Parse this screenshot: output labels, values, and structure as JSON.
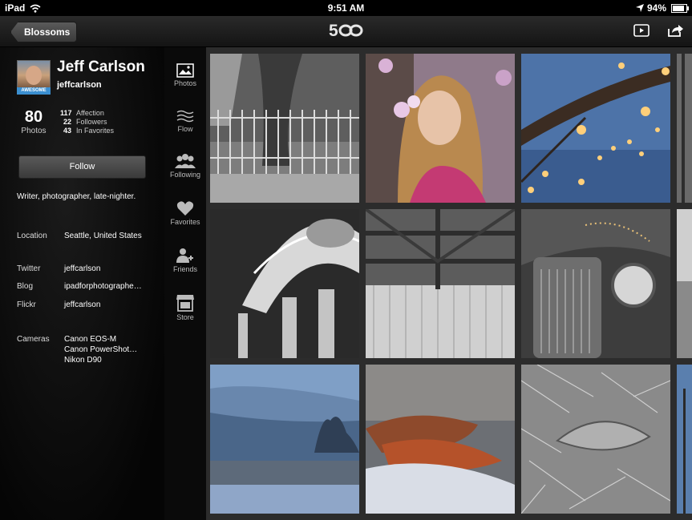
{
  "status_bar": {
    "device": "iPad",
    "time": "9:51 AM",
    "battery": "94%"
  },
  "nav": {
    "back_label": "Blossoms",
    "logo": "500"
  },
  "profile": {
    "name": "Jeff Carlson",
    "username": "jeffcarlson",
    "badge": "AWESOME",
    "photos_count": "80",
    "photos_label": "Photos",
    "stats": [
      {
        "value": "117",
        "label": "Affection"
      },
      {
        "value": "22",
        "label": "Followers"
      },
      {
        "value": "43",
        "label": "In Favorites"
      }
    ],
    "follow_label": "Follow",
    "bio": "Writer, photographer, late-nighter.",
    "location_label": "Location",
    "location_value": "Seattle, United States",
    "twitter_label": "Twitter",
    "twitter_value": "jeffcarlson",
    "blog_label": "Blog",
    "blog_value": "ipadforphotographe…",
    "flickr_label": "Flickr",
    "flickr_value": "jeffcarlson",
    "cameras_label": "Cameras",
    "cameras": [
      "Canon EOS-M",
      "Canon PowerShot…",
      "Nikon D90"
    ]
  },
  "sections": [
    {
      "label": "Photos",
      "icon": "photos-icon"
    },
    {
      "label": "Flow",
      "icon": "flow-icon"
    },
    {
      "label": "Following",
      "icon": "following-icon"
    },
    {
      "label": "Favorites",
      "icon": "favorites-icon"
    },
    {
      "label": "Friends",
      "icon": "friends-icon"
    },
    {
      "label": "Store",
      "icon": "store-icon"
    }
  ],
  "colors": {
    "badge": "#3b8fd0",
    "background": "#0b0b0b"
  }
}
